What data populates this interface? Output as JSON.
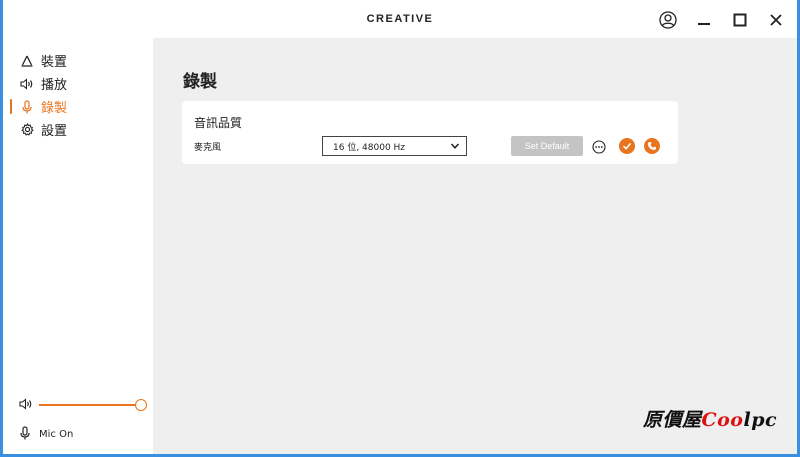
{
  "titlebar": {
    "brand": "CREATIVE"
  },
  "sidebar": {
    "items": [
      {
        "label": "裝置",
        "icon": "device-icon"
      },
      {
        "label": "播放",
        "icon": "speaker-icon"
      },
      {
        "label": "錄製",
        "icon": "microphone-icon",
        "active": true
      },
      {
        "label": "設置",
        "icon": "gear-icon"
      }
    ],
    "volume_level": 1.0,
    "mic_status": "Mic On"
  },
  "main": {
    "page_title": "錄製",
    "card": {
      "title": "音訊品質",
      "row_label": "麥克風",
      "select_value": "16 位, 48000 Hz",
      "set_default_label": "Set Default"
    }
  },
  "watermark": {
    "prefix": "原價屋",
    "brand_red": "Coo",
    "brand_tail": "lpc"
  },
  "colors": {
    "accent": "#e8741d",
    "main_bg": "#efefef",
    "button_disabled": "#c4c4c4"
  }
}
